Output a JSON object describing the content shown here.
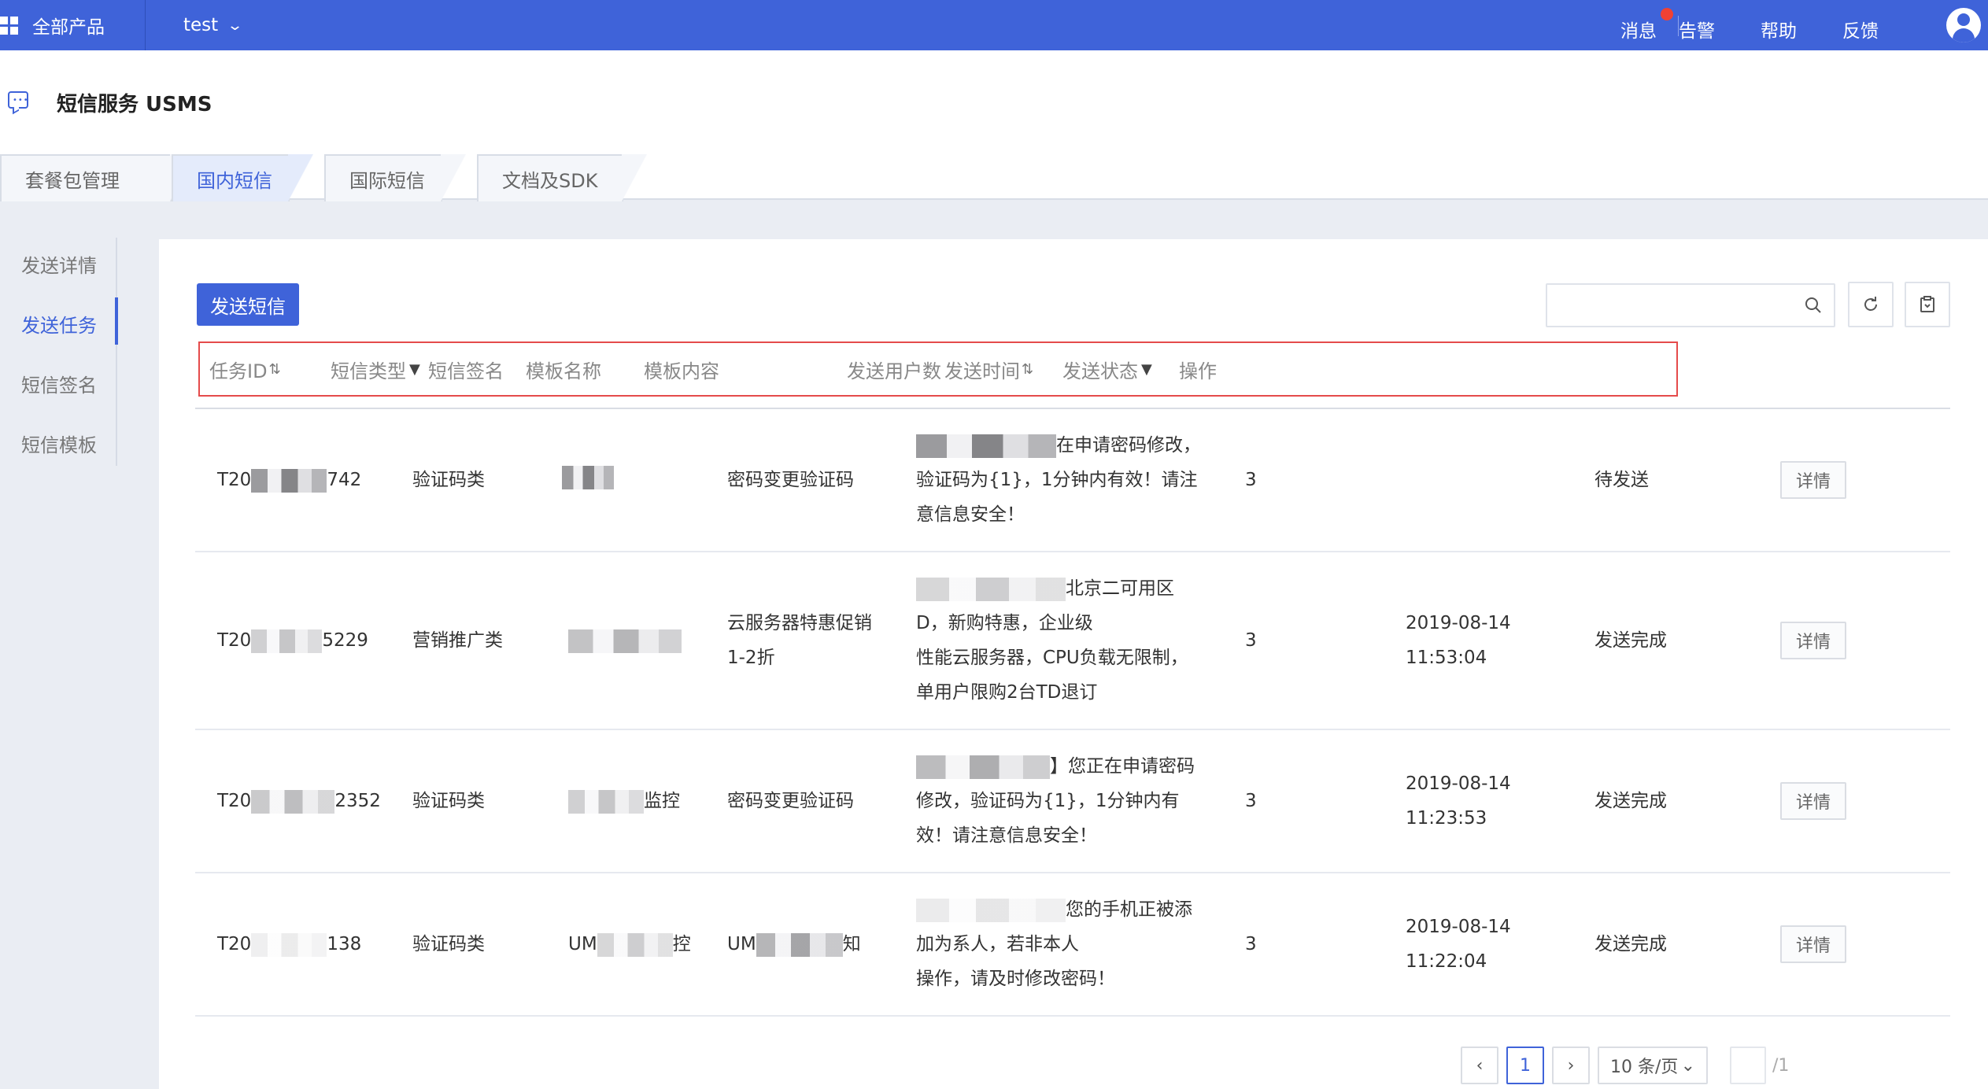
{
  "topbar": {
    "products_label": "全部产品",
    "project_label": "test",
    "links": {
      "messages": "消息",
      "alarms": "告警",
      "help": "帮助",
      "feedback": "反馈"
    },
    "accent_color": "#3f63d9"
  },
  "service": {
    "title": "短信服务 USMS",
    "tabs": [
      "套餐包管理",
      "国内短信",
      "国际短信",
      "文档及SDK"
    ],
    "active_tab": "国内短信"
  },
  "sidenav": {
    "items": [
      "发送详情",
      "发送任务",
      "短信签名",
      "短信模板"
    ],
    "active_item": "发送任务"
  },
  "toolbar": {
    "send_button": "发送短信",
    "search_placeholder": ""
  },
  "table": {
    "columns": [
      "任务ID",
      "短信类型",
      "短信签名",
      "模板名称",
      "模板内容",
      "发送用户数",
      "发送时间",
      "发送状态",
      "操作"
    ],
    "rows": [
      {
        "task_id_prefix": "T20",
        "task_id_suffix": "742",
        "type": "验证码类",
        "signature_prefix": "",
        "signature_suffix": "",
        "template_name": [
          "密码变更验证码"
        ],
        "content": [
          "在申请密码修改，",
          "验证码为{1}，1分钟内有效！请注",
          "意信息安全！"
        ],
        "user_count": "3",
        "send_date": "",
        "send_time": "",
        "status": "待发送",
        "action": "详情"
      },
      {
        "task_id_prefix": "T20",
        "task_id_suffix": "5229",
        "type": "营销推广类",
        "signature_prefix": "",
        "signature_suffix": "",
        "template_name": [
          "云服务器特惠促销",
          "1-2折"
        ],
        "content": [
          "北京二可用区",
          "D，新购特惠，企业级",
          "性能云服务器，CPU负载无限制，",
          "单用户限购2台TD退订"
        ],
        "user_count": "3",
        "send_date": "2019-08-14",
        "send_time": "11:53:04",
        "status": "发送完成",
        "action": "详情"
      },
      {
        "task_id_prefix": "T20",
        "task_id_suffix": "2352",
        "type": "验证码类",
        "signature_prefix": "",
        "signature_suffix": "监控",
        "template_name": [
          "密码变更验证码"
        ],
        "content": [
          "】您正在申请密码",
          "修改，验证码为{1}，1分钟内有",
          "效！请注意信息安全！"
        ],
        "user_count": "3",
        "send_date": "2019-08-14",
        "send_time": "11:23:53",
        "status": "发送完成",
        "action": "详情"
      },
      {
        "task_id_prefix": "T20",
        "task_id_suffix": "138",
        "type": "验证码类",
        "signature_prefix": "UM",
        "signature_suffix": "控",
        "template_name_prefix": "UM",
        "template_name_suffix": "知",
        "template_name": [],
        "content": [
          "您的手机正被添",
          "加为系人，若非本人",
          "操作，请及时修改密码！"
        ],
        "user_count": "3",
        "send_date": "2019-08-14",
        "send_time": "11:22:04",
        "status": "发送完成",
        "action": "详情"
      }
    ]
  },
  "pagination": {
    "current_page": "1",
    "page_size": "10 条/页",
    "total_pages": "/1"
  }
}
